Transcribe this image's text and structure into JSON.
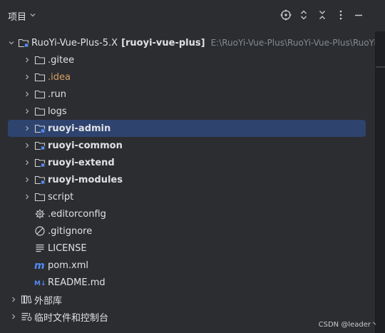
{
  "header": {
    "title": "项目",
    "icons": [
      "target-icon",
      "expand-icon",
      "collapse-icon",
      "more-icon",
      "minimize-icon"
    ]
  },
  "tree": {
    "root": {
      "name": "RuoYi-Vue-Plus-5.X",
      "module": "[ruoyi-vue-plus]",
      "path": "E:\\RuoYi-Vue-Plus\\RuoYi-Vue-Plus\\RuoYi-Vu"
    },
    "items": [
      {
        "label": ".gitee",
        "type": "folder"
      },
      {
        "label": ".idea",
        "type": "folder"
      },
      {
        "label": ".run",
        "type": "folder"
      },
      {
        "label": "logs",
        "type": "folder"
      },
      {
        "label": "ruoyi-admin",
        "type": "module"
      },
      {
        "label": "ruoyi-common",
        "type": "module"
      },
      {
        "label": "ruoyi-extend",
        "type": "module"
      },
      {
        "label": "ruoyi-modules",
        "type": "module"
      },
      {
        "label": "script",
        "type": "folder"
      },
      {
        "label": ".editorconfig",
        "type": "file"
      },
      {
        "label": ".gitignore",
        "type": "file"
      },
      {
        "label": "LICENSE",
        "type": "file"
      },
      {
        "label": "pom.xml",
        "type": "file"
      },
      {
        "label": "README.md",
        "type": "file"
      }
    ],
    "bottom": [
      {
        "label": "外部库"
      },
      {
        "label": "临时文件和控制台"
      }
    ]
  },
  "colors": {
    "background": "#2b2d30",
    "selection": "#2e436e",
    "idea_orange": "#d5a066",
    "module_blue": "#548af7"
  },
  "watermark": "CSDN @leader丶"
}
